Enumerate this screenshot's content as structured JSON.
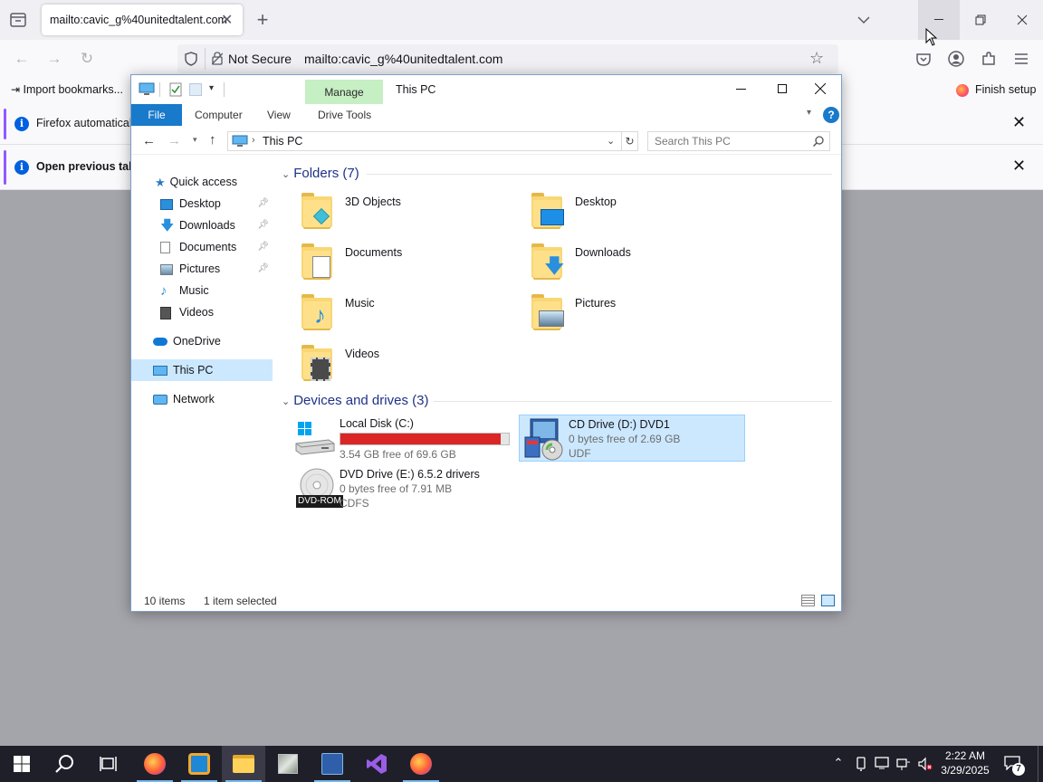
{
  "browser": {
    "tab_title": "mailto:cavic_g%40unitedtalent.com",
    "security_label": "Not Secure",
    "url": "mailto:cavic_g%40unitedtalent.com",
    "import_bookmarks": "Import bookmarks...",
    "finish_setup": "Finish setup",
    "notifications": [
      {
        "text": "Firefox automatically sends some data to Mozilla so that we can improve your experience."
      },
      {
        "text": "Open previous tabs?"
      }
    ]
  },
  "explorer": {
    "title": "This PC",
    "context_tab": "Manage",
    "ribbon_tabs": {
      "file": "File",
      "computer": "Computer",
      "view": "View",
      "drive_tools": "Drive Tools"
    },
    "address": "This PC",
    "search_placeholder": "Search This PC",
    "nav": {
      "quick_access": "Quick access",
      "desktop": "Desktop",
      "downloads": "Downloads",
      "documents": "Documents",
      "pictures": "Pictures",
      "music": "Music",
      "videos": "Videos",
      "onedrive": "OneDrive",
      "this_pc": "This PC",
      "network": "Network"
    },
    "folders_header": "Folders (7)",
    "folders": [
      "3D Objects",
      "Desktop",
      "Documents",
      "Downloads",
      "Music",
      "Pictures",
      "Videos"
    ],
    "devices_header": "Devices and drives (3)",
    "drives": {
      "c": {
        "name": "Local Disk (C:)",
        "free": "3.54 GB free of 69.6 GB",
        "used_fraction": 0.95
      },
      "d": {
        "name": "CD Drive (D:) DVD1",
        "free": "0 bytes free of 2.69 GB",
        "fs": "UDF"
      },
      "e": {
        "name": "DVD Drive (E:) 6.5.2 drivers",
        "free": "0 bytes free of 7.91 MB",
        "fs": "CDFS",
        "badge": "DVD-ROM"
      }
    },
    "status": {
      "items": "10 items",
      "selected": "1 item selected"
    }
  },
  "taskbar": {
    "time": "2:22 AM",
    "date": "3/29/2025",
    "notification_count": "7"
  }
}
